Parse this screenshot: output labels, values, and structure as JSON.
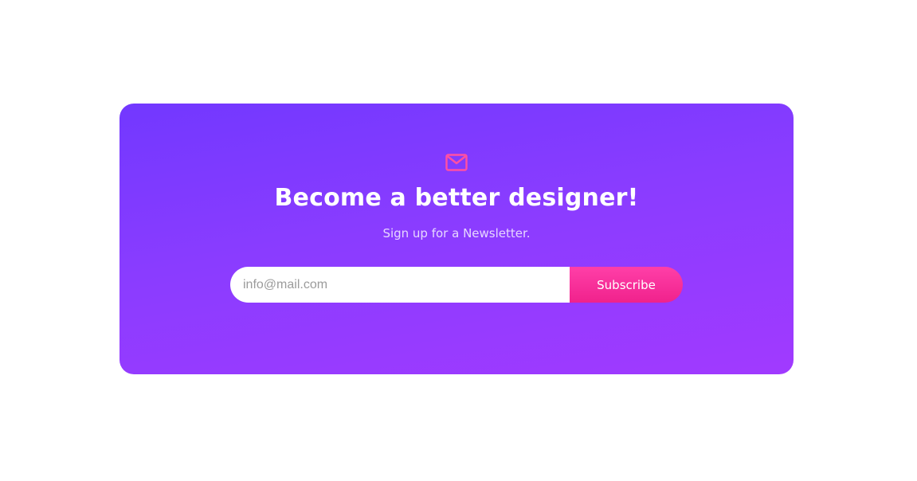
{
  "newsletter": {
    "icon": "envelope-icon",
    "title": "Become a better designer!",
    "subtitle": "Sign up for a Newsletter.",
    "email_placeholder": "info@mail.com",
    "email_value": "",
    "subscribe_label": "Subscribe"
  },
  "colors": {
    "card_gradient_start": "#7238ff",
    "card_gradient_end": "#a13aff",
    "accent": "#f0228c",
    "icon": "#ff4fa3"
  }
}
